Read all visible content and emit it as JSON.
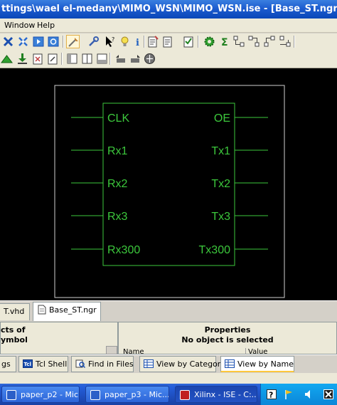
{
  "window": {
    "title": "ttings\\wael el-medany\\MIMO_WSN\\MIMO_WSN.ise - [Base_ST.ngr]"
  },
  "menu": {
    "items": [
      "Window",
      "Help"
    ]
  },
  "schematic": {
    "left_ports": [
      "CLK",
      "Rx1",
      "Rx2",
      "Rx3",
      "Rx300"
    ],
    "right_ports": [
      "OE",
      "Tx1",
      "Tx2",
      "Tx3",
      "Tx300"
    ],
    "colors": {
      "background": "#000000",
      "border": "#d0d0d0",
      "symbol": "#3cc83c"
    }
  },
  "doc_tabs": [
    {
      "label": "T.vhd",
      "active": false
    },
    {
      "label": "Base_ST.ngr",
      "active": true
    }
  ],
  "left_panel": {
    "line1": "cts of",
    "line2": "ymbol"
  },
  "properties_panel": {
    "title": "Properties",
    "status": "No object is selected",
    "columns": [
      "Name",
      "Value"
    ]
  },
  "bottom_tabs": [
    {
      "label": "gs",
      "icon": "console-icon",
      "active": false
    },
    {
      "label": "Tcl Shell",
      "icon": "tcl-icon",
      "active": false
    },
    {
      "label": "Find in Files",
      "icon": "find-icon",
      "active": false
    },
    {
      "label": "View by Category",
      "icon": "table-icon",
      "active": false
    },
    {
      "label": "View by Name",
      "icon": "table-icon",
      "active": true
    }
  ],
  "taskbar": {
    "buttons": [
      {
        "label": "paper_p2 - Mic...",
        "icon": "word-icon",
        "active": false
      },
      {
        "label": "paper_p3 - Mic...",
        "icon": "word-icon",
        "active": false
      },
      {
        "label": "Xilinx - ISE - C:...",
        "icon": "xilinx-icon",
        "active": true
      }
    ],
    "tray_icons": [
      "help-icon",
      "flag-icon",
      "audio-icon",
      "x-icon"
    ]
  }
}
